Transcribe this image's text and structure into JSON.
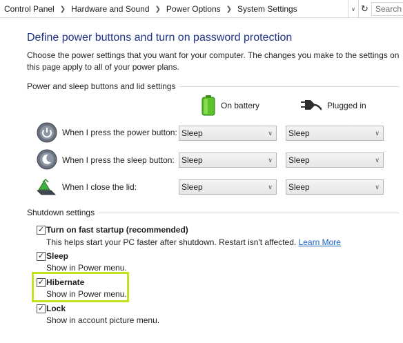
{
  "addressbar": {
    "crumbs": [
      "Control Panel",
      "Hardware and Sound",
      "Power Options",
      "System Settings"
    ],
    "search_placeholder": "Search Control Panel",
    "search_visible": "Search C"
  },
  "page": {
    "title": "Define power buttons and turn on password protection",
    "description": "Choose the power settings that you want for your computer. The changes you make to the settings on this page apply to all of your power plans."
  },
  "power_group": {
    "label": "Power and sleep buttons and lid settings",
    "columns": {
      "battery": "On battery",
      "plugged": "Plugged in"
    },
    "rows": [
      {
        "label": "When I press the power button:",
        "battery": "Sleep",
        "plugged": "Sleep",
        "icon": "power-button-icon"
      },
      {
        "label": "When I press the sleep button:",
        "battery": "Sleep",
        "plugged": "Sleep",
        "icon": "sleep-button-icon"
      },
      {
        "label": "When I close the lid:",
        "battery": "Sleep",
        "plugged": "Sleep",
        "icon": "laptop-lid-icon"
      }
    ]
  },
  "shutdown_group": {
    "label": "Shutdown settings",
    "items": [
      {
        "label": "Turn on fast startup (recommended)",
        "desc": "This helps start your PC faster after shutdown. Restart isn't affected.",
        "link": "Learn More",
        "checked": true
      },
      {
        "label": "Sleep",
        "desc": "Show in Power menu.",
        "checked": true
      },
      {
        "label": "Hibernate",
        "desc": "Show in Power menu.",
        "checked": true
      },
      {
        "label": "Lock",
        "desc": "Show in account picture menu.",
        "checked": true
      }
    ]
  },
  "colors": {
    "title": "#1e3287",
    "link": "#1863c9",
    "highlight": "#c3e21f"
  }
}
